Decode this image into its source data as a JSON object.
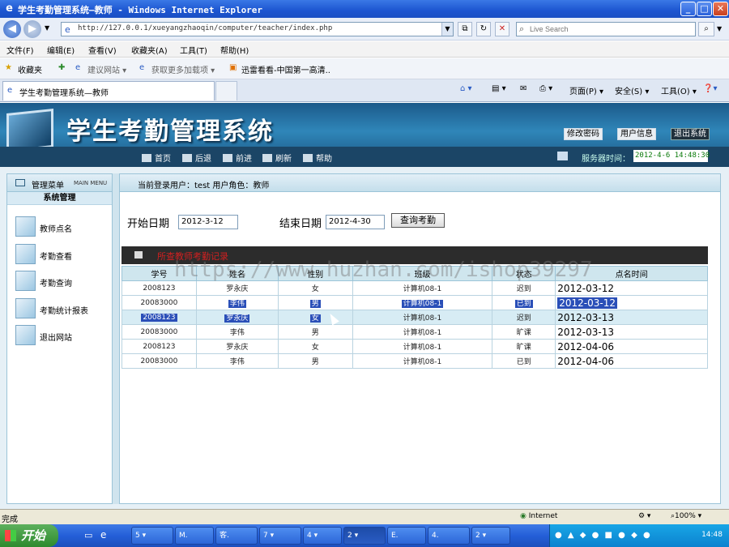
{
  "window": {
    "title": "学生考勤管理系统—教师 - Windows Internet Explorer",
    "min": "_",
    "max": "□",
    "close": "✕"
  },
  "address": {
    "url": "http://127.0.0.1/xueyangzhaoqin/computer/teacher/index.php",
    "search_placeholder": "Live Search"
  },
  "menubar": [
    "文件(F)",
    "编辑(E)",
    "查看(V)",
    "收藏夹(A)",
    "工具(T)",
    "帮助(H)"
  ],
  "favorites": {
    "label": "收藏夹",
    "items": [
      "建议网站 ▾",
      "获取更多加载项 ▾",
      "迅雷看看-中国第一高清.."
    ]
  },
  "tabs": {
    "active_title": "学生考勤管理系统—教师"
  },
  "commandbar": {
    "page": "页面(P) ▾",
    "safety": "安全(S) ▾",
    "tools": "工具(O) ▾"
  },
  "app": {
    "system_name": "学生考勤管理系统",
    "header_buttons": [
      "修改密码",
      "用户信息",
      "退出系统"
    ],
    "nav": [
      "首页",
      "后退",
      "前进",
      "刷新",
      "帮助"
    ],
    "server_time_label": "服务器时间：",
    "server_time": "2012-4-6 14:48:30",
    "sidebar": {
      "title": "管理菜单",
      "title_en": "MAIN MENU",
      "group": "系统管理",
      "items": [
        "教师点名",
        "考勤查看",
        "考勤查询",
        "考勤统计报表",
        "退出网站"
      ]
    },
    "current_user": "当前登录用户：test  用户角色：教师",
    "form": {
      "start_label": "开始日期",
      "start_value": "2012-3-12",
      "end_label": "结束日期",
      "end_value": "2012-4-30",
      "query_button": "查询考勤"
    },
    "result_title": "所查教师考勤记录",
    "table": {
      "headers": [
        "学号",
        "姓名",
        "性别",
        "班级",
        "状态",
        "点名时间"
      ],
      "rows": [
        [
          "2008123",
          "罗永庆",
          "女",
          "计算机08-1",
          "迟到",
          "2012-03-12"
        ],
        [
          "20083000",
          "李伟",
          "男",
          "计算机08-1",
          "已到",
          "2012-03-12"
        ],
        [
          "2008123",
          "罗永庆",
          "女",
          "计算机08-1",
          "迟到",
          "2012-03-13"
        ],
        [
          "20083000",
          "李伟",
          "男",
          "计算机08-1",
          "旷课",
          "2012-03-13"
        ],
        [
          "2008123",
          "罗永庆",
          "女",
          "计算机08-1",
          "旷课",
          "2012-04-06"
        ],
        [
          "20083000",
          "李伟",
          "男",
          "计算机08-1",
          "已到",
          "2012-04-06"
        ]
      ]
    }
  },
  "watermark": "https://www.huzhan.com/ishop39297",
  "statusbar": {
    "status": "完成",
    "zone": "Internet",
    "zoom": "100%"
  },
  "taskbar": {
    "start": "开始",
    "tasks": [
      "5 ▾",
      "M.",
      "客.",
      "7 ▾",
      "4 ▾",
      "2 ▾",
      "E.",
      "4.",
      "2 ▾"
    ],
    "clock": "14:48"
  }
}
